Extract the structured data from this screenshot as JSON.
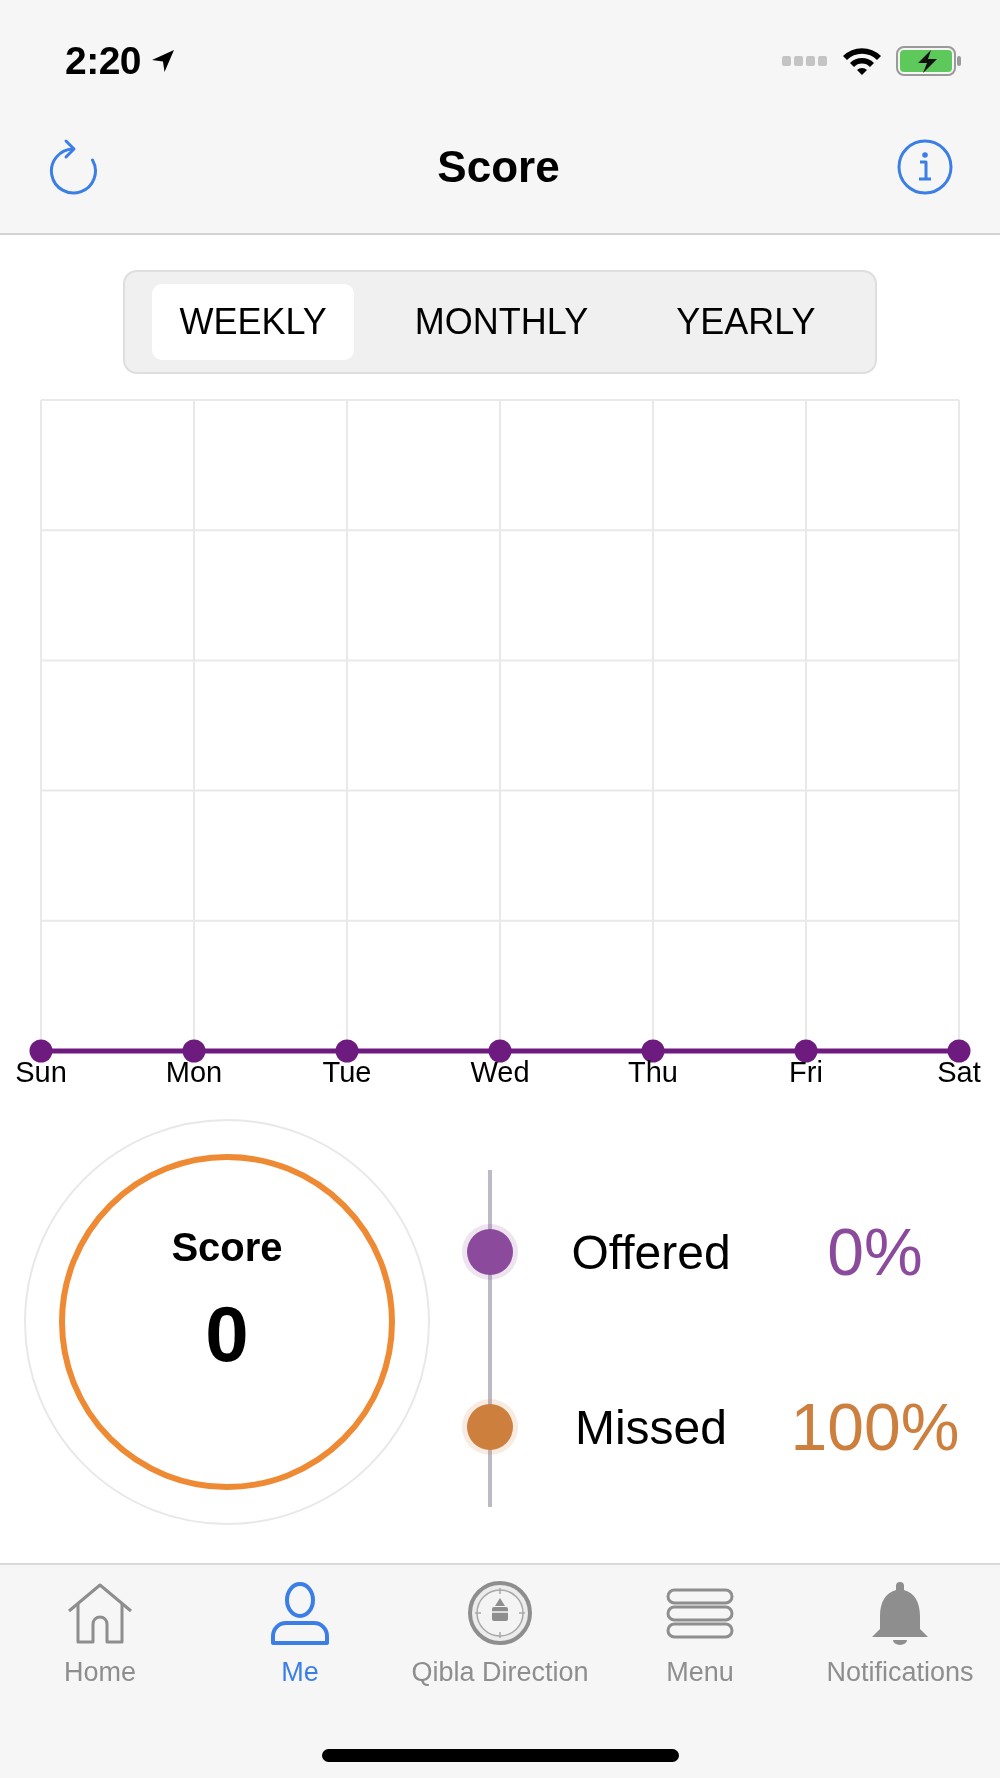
{
  "status_bar": {
    "time": "2:20"
  },
  "nav_bar": {
    "title": "Score"
  },
  "period_tabs": [
    {
      "label": "WEEKLY",
      "selected": true
    },
    {
      "label": "MONTHLY",
      "selected": false
    },
    {
      "label": "YEARLY",
      "selected": false
    }
  ],
  "chart": {
    "x_labels": [
      "Sun",
      "Mon",
      "Tue",
      "Wed",
      "Thu",
      "Fri",
      "Sat"
    ]
  },
  "score": {
    "label": "Score",
    "value": "0"
  },
  "legend": [
    {
      "label": "Offered",
      "percent": "0%",
      "color": "#8b4a9c"
    },
    {
      "label": "Missed",
      "percent": "100%",
      "color": "#cd7f3e"
    }
  ],
  "tab_bar": [
    {
      "label": "Home",
      "selected": false
    },
    {
      "label": "Me",
      "selected": true
    },
    {
      "label": "Qibla Direction",
      "selected": false
    },
    {
      "label": "Menu",
      "selected": false
    },
    {
      "label": "Notifications",
      "selected": false
    }
  ]
}
